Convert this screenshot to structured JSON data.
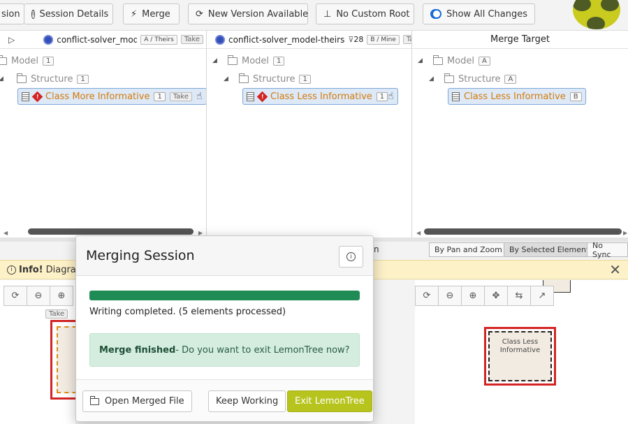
{
  "toolbar": {
    "session_partial": "sion",
    "session_details": "Session Details",
    "merge": "Merge",
    "new_version": "New Version Available",
    "no_custom_root": "No Custom Root",
    "show_all_changes": "Show All Changes"
  },
  "panes": {
    "theirs": {
      "title": "conflict-solver_mode",
      "badge": "A / Theirs",
      "take": "Take",
      "model": "Model",
      "model_count": "1",
      "structure": "Structure",
      "structure_count": "1",
      "class_name": "Class More Informative",
      "class_count": "1",
      "class_take": "Take"
    },
    "mine": {
      "title": "conflict-solver_model-theirs",
      "filter_suffix": "28",
      "badge": "B / Mine",
      "take": "Take",
      "model": "Model",
      "model_count": "1",
      "structure": "Structure",
      "structure_count": "1",
      "class_name": "Class Less Informative",
      "class_count": "1"
    },
    "target": {
      "title": "Merge Target",
      "model": "Model",
      "model_badge": "A",
      "structure": "Structure",
      "structure_badge": "A",
      "class_name": "Class Less Informative",
      "class_badge": "B"
    }
  },
  "lower": {
    "sync_pan_zoom": "By Pan and Zoom",
    "sync_selected": "By Selected Element",
    "sync_none": "No Sync",
    "info_label": "Info!",
    "info_text": "Diagram",
    "take": "Take",
    "partial_n": "n",
    "target_node_label": "Class Less Informative"
  },
  "modal": {
    "title": "Merging Session",
    "progress_percent": 100,
    "status": "Writing completed. (5 elements processed)",
    "alert_bold": "Merge finished",
    "alert_text": " - Do you want to exit LemonTree now?",
    "open_merged": "Open Merged File",
    "keep_working": "Keep Working",
    "exit": "Exit LemonTree"
  },
  "colors": {
    "accent_blue": "#1a6ad6",
    "progress_green": "#1f8b55",
    "exit_button": "#b7c41d",
    "conflict_red": "#d32323",
    "class_orange": "#d27b0d"
  }
}
